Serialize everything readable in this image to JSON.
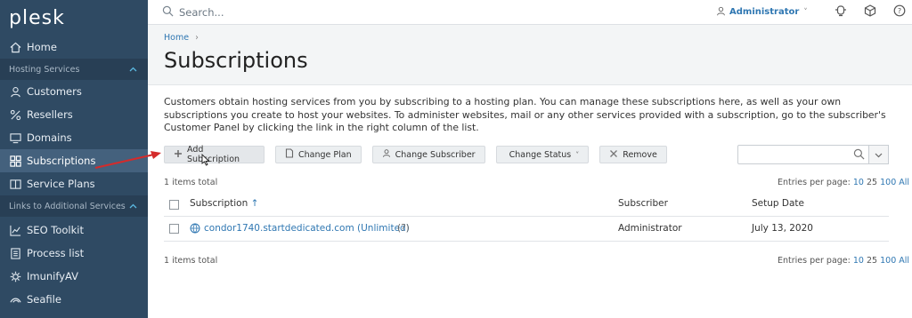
{
  "sidebar": {
    "logo": "plesk",
    "home": "Home",
    "section_hosting": "Hosting Services",
    "customers": "Customers",
    "resellers": "Resellers",
    "domains": "Domains",
    "subscriptions": "Subscriptions",
    "service_plans": "Service Plans",
    "section_links": "Links to Additional Services",
    "seo_toolkit": "SEO Toolkit",
    "process_list": "Process list",
    "imunifyav": "ImunifyAV",
    "seafile": "Seafile"
  },
  "topbar": {
    "search_placeholder": "Search...",
    "user": "Administrator",
    "user_caret": "˅"
  },
  "breadcrumb": {
    "home": "Home",
    "sep": "›"
  },
  "page": {
    "title": "Subscriptions",
    "description": "Customers obtain hosting services from you by subscribing to a hosting plan. You can manage these subscriptions here, as well as your own subscriptions you create to host your websites. To administer websites, mail or any other services provided with a subscription, go to the subscriber's Customer Panel by clicking the link in the right column of the list."
  },
  "toolbar": {
    "add": "Add Subscription",
    "change_plan": "Change Plan",
    "change_subscriber": "Change Subscriber",
    "change_status": "Change Status",
    "remove": "Remove"
  },
  "list": {
    "total_top": "1 items total",
    "total_bottom": "1 items total",
    "entries_label": "Entries per page:",
    "entries_options": [
      "10",
      "25",
      "100",
      "All"
    ],
    "columns": {
      "subscription": "Subscription",
      "sort_icon": "↑",
      "subscriber": "Subscriber",
      "setup_date": "Setup Date"
    },
    "rows": [
      {
        "subscription": "condor1740.startdedicated.com (Unlimited)",
        "help": "(?)",
        "subscriber": "Administrator",
        "setup_date": "July 13, 2020"
      }
    ]
  },
  "colors": {
    "sidebar_bg": "#2f4a63",
    "accent": "#2f77b2",
    "arrow": "#d42b2b"
  }
}
